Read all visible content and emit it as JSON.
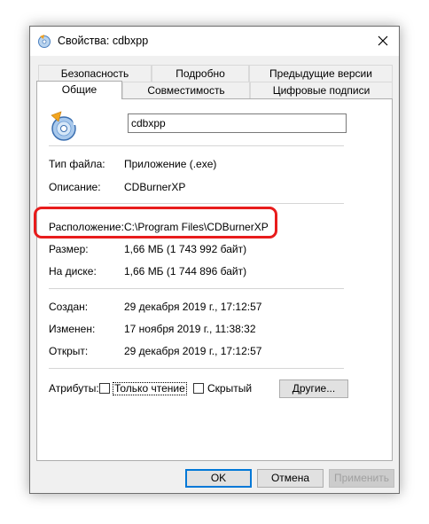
{
  "window": {
    "title": "Свойства: cdbxpp"
  },
  "tabs_row1": [
    {
      "label": "Безопасность"
    },
    {
      "label": "Подробно"
    },
    {
      "label": "Предыдущие версии"
    }
  ],
  "tabs_row2": [
    {
      "label": "Общие",
      "active": true
    },
    {
      "label": "Совместимость"
    },
    {
      "label": "Цифровые подписи"
    }
  ],
  "general": {
    "file_name": "cdbxpp",
    "file_type_label": "Тип файла:",
    "file_type_value": "Приложение (.exe)",
    "description_label": "Описание:",
    "description_value": "CDBurnerXP",
    "location_label": "Расположение:",
    "location_value": "C:\\Program Files\\CDBurnerXP",
    "size_label": "Размер:",
    "size_value": "1,66 МБ (1 743 992 байт)",
    "disk_size_label": "На диске:",
    "disk_size_value": "1,66 МБ (1 744 896 байт)",
    "created_label": "Создан:",
    "created_value": "29 декабря 2019 г., 17:12:57",
    "modified_label": "Изменен:",
    "modified_value": "17 ноября 2019 г., 11:38:32",
    "accessed_label": "Открыт:",
    "accessed_value": "29 декабря 2019 г., 17:12:57",
    "attributes_label": "Атрибуты:",
    "readonly_label": "Только чтение",
    "readonly_checked": false,
    "hidden_label": "Скрытый",
    "hidden_checked": false,
    "other_button": "Другие..."
  },
  "buttons": {
    "ok": "OK",
    "cancel": "Отмена",
    "apply": "Применить"
  },
  "colors": {
    "highlight": "#e81c1c",
    "focus": "#0078d7"
  }
}
